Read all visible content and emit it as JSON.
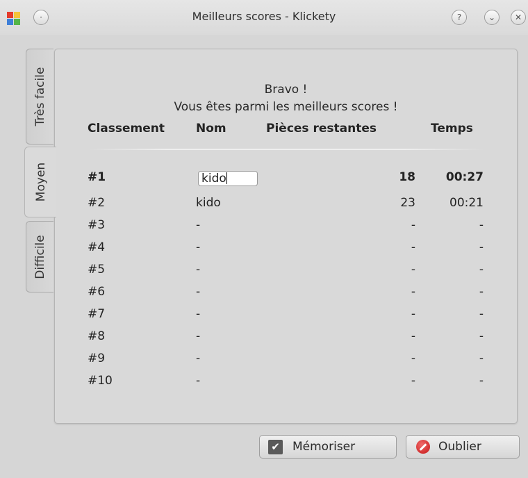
{
  "window": {
    "title": "Meilleurs scores - Klickety",
    "controls": {
      "help": "?",
      "minimize": "⌄",
      "close": "✕"
    }
  },
  "tabs": [
    {
      "label": "Très facile",
      "active": false
    },
    {
      "label": "Moyen",
      "active": true
    },
    {
      "label": "Difficile",
      "active": false
    }
  ],
  "message": {
    "line1": "Bravo !",
    "line2": "Vous êtes parmi les meilleurs scores !"
  },
  "table": {
    "headers": {
      "rank": "Classement",
      "name": "Nom",
      "pieces": "Pièces restantes",
      "time": "Temps"
    },
    "rows": [
      {
        "rank": "#1",
        "name": "kido",
        "pieces": "18",
        "time": "00:27"
      },
      {
        "rank": "#2",
        "name": "kido",
        "pieces": "23",
        "time": "00:21"
      },
      {
        "rank": "#3",
        "name": "-",
        "pieces": "-",
        "time": "-"
      },
      {
        "rank": "#4",
        "name": "-",
        "pieces": "-",
        "time": "-"
      },
      {
        "rank": "#5",
        "name": "-",
        "pieces": "-",
        "time": "-"
      },
      {
        "rank": "#6",
        "name": "-",
        "pieces": "-",
        "time": "-"
      },
      {
        "rank": "#7",
        "name": "-",
        "pieces": "-",
        "time": "-"
      },
      {
        "rank": "#8",
        "name": "-",
        "pieces": "-",
        "time": "-"
      },
      {
        "rank": "#9",
        "name": "-",
        "pieces": "-",
        "time": "-"
      },
      {
        "rank": "#10",
        "name": "-",
        "pieces": "-",
        "time": "-"
      }
    ]
  },
  "buttons": {
    "save": "Mémoriser",
    "forget": "Oublier"
  },
  "colors": {
    "background": "#d6d6d6",
    "check_icon": "#5a5a5a",
    "stop_icon": "#c51515"
  }
}
